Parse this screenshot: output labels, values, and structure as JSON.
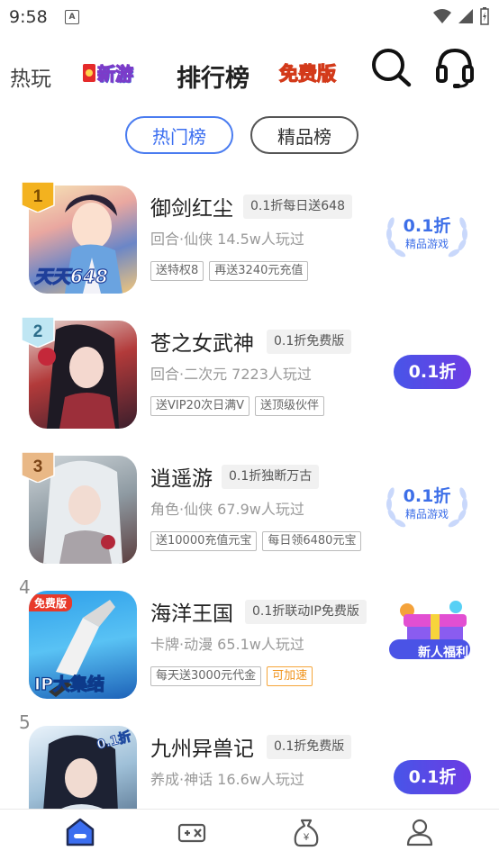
{
  "status": {
    "time": "9:58"
  },
  "topnav": {
    "hot": "热玩",
    "new": "新游",
    "rank": "排行榜",
    "free": "免费版"
  },
  "tabs": [
    {
      "label": "热门榜",
      "active": true
    },
    {
      "label": "精品榜",
      "active": false
    }
  ],
  "games": [
    {
      "rank": "1",
      "title": "御剑红尘",
      "promo": "0.1折每日送648",
      "meta": "回合·仙侠  14.5w人玩过",
      "tags": [
        "送特权8",
        "再送3240元充值"
      ],
      "action": {
        "type": "laurel",
        "big": "0.1折",
        "small": "精品游戏"
      },
      "thumb_text": "天天648"
    },
    {
      "rank": "2",
      "title": "苍之女武神",
      "promo": "0.1折免费版",
      "meta": "回合·二次元  7223人玩过",
      "tags": [
        "送VIP20次日满V",
        "送顶级伙伴"
      ],
      "action": {
        "type": "pill",
        "label": "0.1折"
      }
    },
    {
      "rank": "3",
      "title": "逍遥游",
      "promo": "0.1折独断万古",
      "meta": "角色·仙侠  67.9w人玩过",
      "tags": [
        "送10000充值元宝",
        "每日领6480元宝"
      ],
      "action": {
        "type": "laurel",
        "big": "0.1折",
        "small": "精品游戏"
      }
    },
    {
      "rank": "4",
      "title": "海洋王国",
      "promo": "0.1折联动IP免费版",
      "meta": "卡牌·动漫  65.1w人玩过",
      "tags": [
        "每天送3000元代金",
        "可加速"
      ],
      "action": {
        "type": "gift",
        "label": "新人福利"
      },
      "thumb_badge": "免费版",
      "thumb_text": "IP大集结"
    },
    {
      "rank": "5",
      "title": "九州异兽记",
      "promo": "0.1折免费版",
      "meta": "养成·神话  16.6w人玩过",
      "tags": [],
      "action": {
        "type": "pill",
        "label": "0.1折"
      },
      "thumb_badge": "0.1折"
    }
  ],
  "colors": {
    "accent": "#3b6ef0",
    "pill_start": "#4855e8",
    "pill_end": "#6c3ce3",
    "gold": "#f3b21f"
  }
}
